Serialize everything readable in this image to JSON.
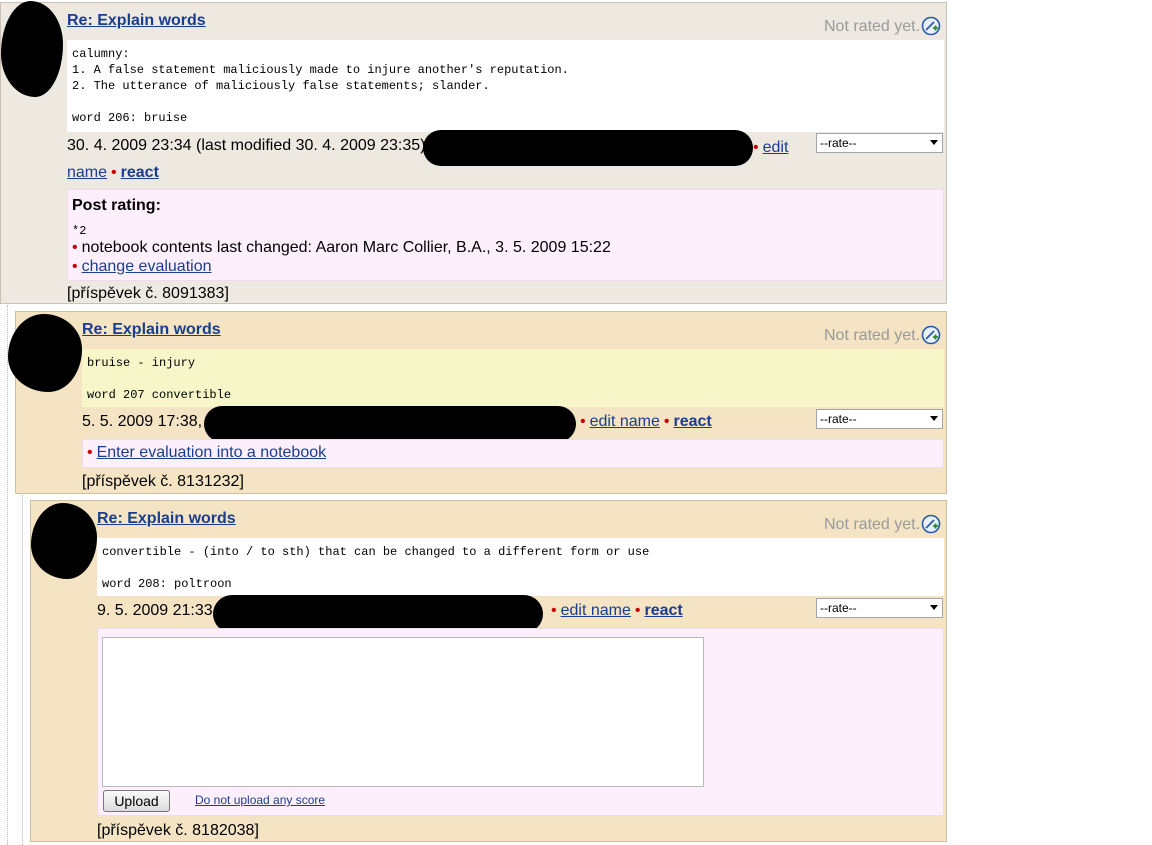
{
  "posts": [
    {
      "title": "Re: Explain words",
      "rating_status": "Not rated yet.",
      "body": "calumny:\n1. A false statement maliciously made to injure another's reputation.\n2. The utterance of maliciously false statements; slander.\n\nword 206: bruise",
      "date": "30. 4. 2009 23:34 (last modified 30. 4. 2009 23:35)",
      "edit_name_part1": "edit",
      "edit_name_part2": "name",
      "react_label": "react",
      "rate_select": "--rate--",
      "eval_heading": "Post rating:",
      "eval_value": "*2",
      "eval_changed": "notebook contents last changed: Aaron Marc Collier, B.A., 3. 5. 2009 15:22",
      "eval_link": "change evaluation",
      "post_id": "[příspěvek č. 8091383]"
    },
    {
      "title": "Re: Explain words",
      "rating_status": "Not rated yet.",
      "body": "bruise - injury\n\nword 207 convertible",
      "date": "5. 5. 2009 17:38,",
      "edit_name_label": "edit name",
      "react_label": "react",
      "rate_select": "--rate--",
      "eval_link": "Enter evaluation into a notebook",
      "post_id": "[příspěvek č. 8131232]"
    },
    {
      "title": "Re: Explain words",
      "rating_status": "Not rated yet.",
      "body": "convertible - (into / to sth) that can be changed to a different form or use\n\nword 208: poltroon",
      "date": "9. 5. 2009 21:33",
      "edit_name_label": "edit name",
      "react_label": "react",
      "rate_select": "--rate--",
      "upload_label": "Upload",
      "no_upload_label": "Do not upload any score",
      "post_id": "[příspěvek č. 8182038]"
    }
  ],
  "colors": {
    "link": "#1a3d8f",
    "bullet": "#cc0000",
    "post1_bg": "#ede9e1",
    "post_bg": "#f4e4c4",
    "eval_bg": "#fdf0fc",
    "yellow_body": "#f6f6c8"
  },
  "icons": [
    "rate-plus-icon",
    "chevron-down-icon"
  ]
}
